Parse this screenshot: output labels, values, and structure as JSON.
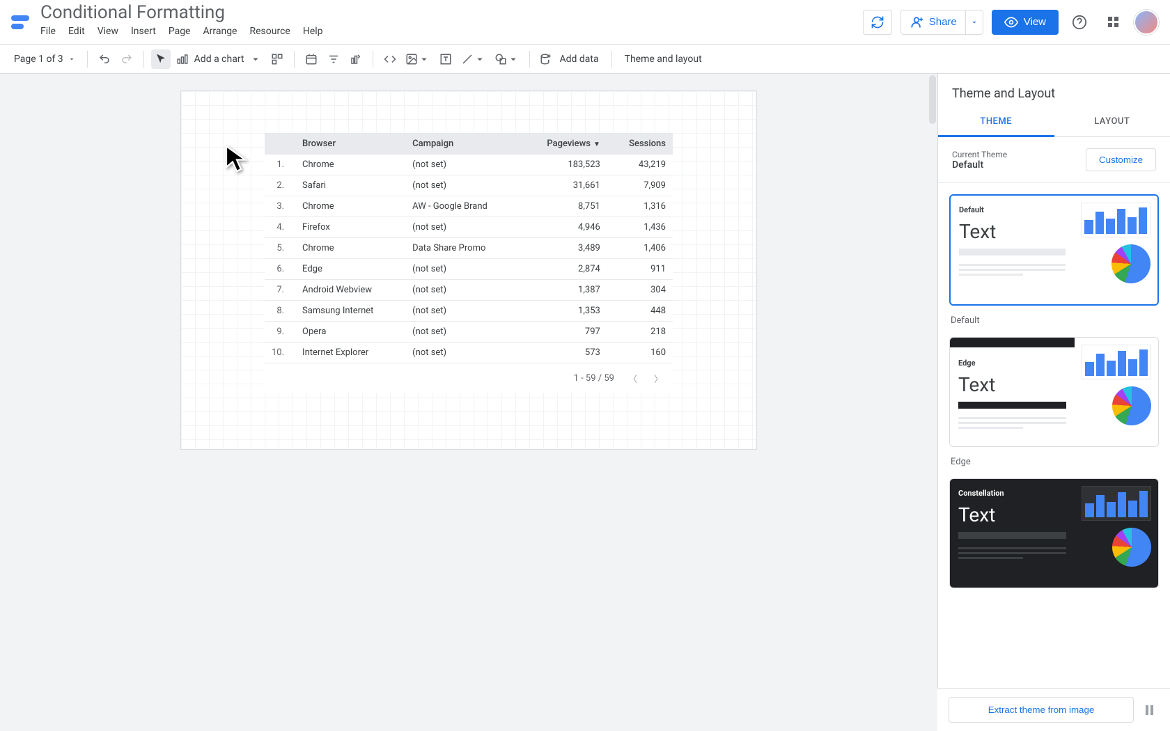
{
  "doc_title": "Conditional Formatting",
  "menubar": [
    "File",
    "Edit",
    "View",
    "Insert",
    "Page",
    "Arrange",
    "Resource",
    "Help"
  ],
  "header": {
    "share": "Share",
    "view": "View"
  },
  "toolbar": {
    "page_label": "Page 1 of 3",
    "add_chart": "Add a chart",
    "add_data": "Add data",
    "theme_layout": "Theme and layout"
  },
  "table": {
    "headers": {
      "idx": "",
      "browser": "Browser",
      "campaign": "Campaign",
      "pageviews": "Pageviews",
      "sessions": "Sessions"
    },
    "sort_col": "pageviews",
    "rows": [
      {
        "idx": "1.",
        "browser": "Chrome",
        "campaign": "(not set)",
        "pageviews": "183,523",
        "sessions": "43,219"
      },
      {
        "idx": "2.",
        "browser": "Safari",
        "campaign": "(not set)",
        "pageviews": "31,661",
        "sessions": "7,909"
      },
      {
        "idx": "3.",
        "browser": "Chrome",
        "campaign": "AW - Google Brand",
        "pageviews": "8,751",
        "sessions": "1,316"
      },
      {
        "idx": "4.",
        "browser": "Firefox",
        "campaign": "(not set)",
        "pageviews": "4,946",
        "sessions": "1,436"
      },
      {
        "idx": "5.",
        "browser": "Chrome",
        "campaign": "Data Share Promo",
        "pageviews": "3,489",
        "sessions": "1,406"
      },
      {
        "idx": "6.",
        "browser": "Edge",
        "campaign": "(not set)",
        "pageviews": "2,874",
        "sessions": "911"
      },
      {
        "idx": "7.",
        "browser": "Android Webview",
        "campaign": "(not set)",
        "pageviews": "1,387",
        "sessions": "304"
      },
      {
        "idx": "8.",
        "browser": "Samsung Internet",
        "campaign": "(not set)",
        "pageviews": "1,353",
        "sessions": "448"
      },
      {
        "idx": "9.",
        "browser": "Opera",
        "campaign": "(not set)",
        "pageviews": "797",
        "sessions": "218"
      },
      {
        "idx": "10.",
        "browser": "Internet Explorer",
        "campaign": "(not set)",
        "pageviews": "573",
        "sessions": "160"
      }
    ],
    "footer": "1 - 59 / 59"
  },
  "panel": {
    "title": "Theme and Layout",
    "tabs": {
      "theme": "THEME",
      "layout": "LAYOUT"
    },
    "current_label": "Current Theme",
    "current_name": "Default",
    "customize": "Customize",
    "themes": [
      {
        "name": "Default",
        "title": "Default",
        "text": "Text"
      },
      {
        "name": "Edge",
        "title": "Edge",
        "text": "Text"
      },
      {
        "name": "Constellation",
        "title": "Constellation",
        "text": "Text"
      }
    ],
    "extract": "Extract theme from image"
  }
}
